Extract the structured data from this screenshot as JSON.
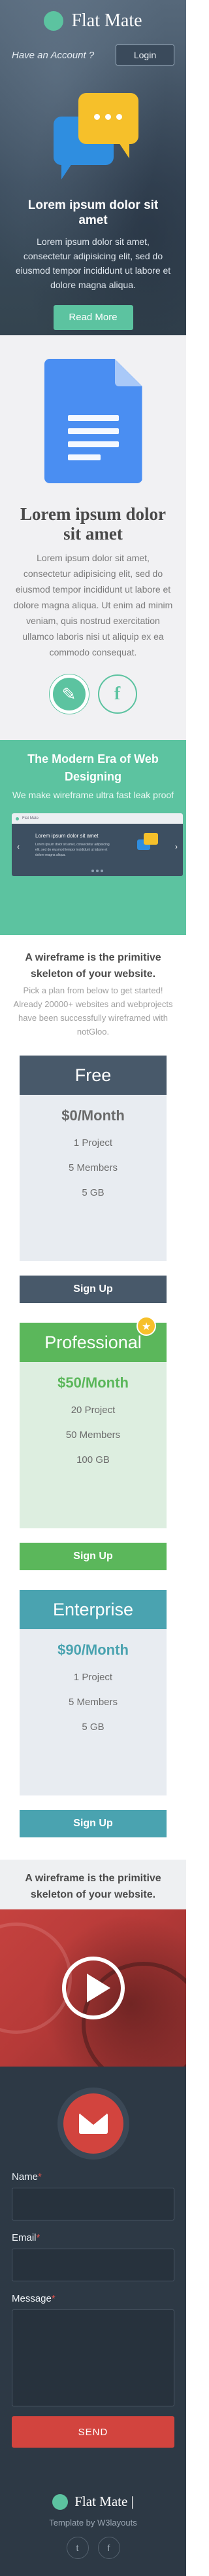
{
  "brand": {
    "name": "Flat Mate"
  },
  "header": {
    "login_question": "Have an Account ?",
    "login_label": "Login"
  },
  "hero": {
    "title": "Lorem ipsum dolor sit amet",
    "text": "Lorem ipsum dolor sit amet, consectetur adipisicing elit, sed do eiusmod tempor incididunt ut labore et dolore magna aliqua.",
    "button_label": "Read More"
  },
  "feature": {
    "title": "Lorem ipsum dolor sit amet",
    "text": "Lorem ipsum dolor sit amet, consectetur adipisicing elit, sed do eiusmod tempor incididunt ut labore et dolore magna aliqua. Ut enim ad minim veniam, quis nostrud exercitation ullamco laboris nisi ut aliquip ex ea commodo consequat.",
    "icons": [
      "pencil-icon",
      "facebook-icon"
    ]
  },
  "promo": {
    "title": "The Modern Era of Web Designing",
    "subtitle": "We make wireframe ultra fast leak proof",
    "mockup": {
      "brand": "Flat Mate",
      "heading": "Lorem ipsum dolor sit amet",
      "text": "Lorem ipsum dolor sit amet, consectetur adipisicing elit, sed do eiusmod tempor incididunt ut labore et dolore magna aliqua."
    }
  },
  "pricing": {
    "title": "A wireframe is the primitive skeleton of your website.",
    "text": "Pick a plan from below to get started! Already 20000+ websites and webprojects have been successfully wireframed with notGloo.",
    "plans": [
      {
        "name": "Free",
        "price": "$0/Month",
        "projects": "1 Project",
        "members": "5 Members",
        "storage": "5 GB",
        "button": "Sign Up"
      },
      {
        "name": "Professional",
        "price": "$50/Month",
        "projects": "20 Project",
        "members": "50 Members",
        "storage": "100 GB",
        "button": "Sign Up"
      },
      {
        "name": "Enterprise",
        "price": "$90/Month",
        "projects": "1 Project",
        "members": "5 Members",
        "storage": "5 GB",
        "button": "Sign Up"
      }
    ]
  },
  "video_section": {
    "tagline": "A wireframe is the primitive skeleton of your website."
  },
  "contact": {
    "name_label": "Name",
    "email_label": "Email",
    "message_label": "Message",
    "required_mark": "*",
    "send_label": "SEND"
  },
  "footer": {
    "brand": "Flat Mate |",
    "credit": "Template by W3layouts",
    "social": [
      "twitter-icon",
      "facebook-icon"
    ]
  },
  "colors": {
    "accent_green": "#5cc3a0",
    "hero_bg": "#3f5163",
    "pro_green": "#5bb75b",
    "enterprise_teal": "#4aa3b0",
    "red": "#d2443e",
    "dark_bg": "#2d3945"
  }
}
